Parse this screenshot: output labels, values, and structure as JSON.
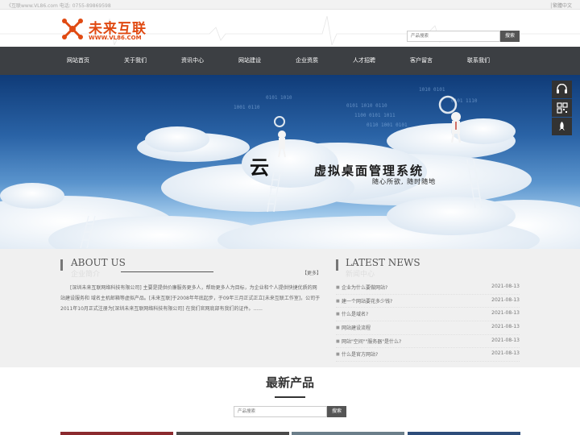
{
  "topbar": {
    "left_text": "《互联www.VL86.com 电话: 0755-89869598",
    "right_text": "│繁體中文"
  },
  "header": {
    "logo_name": "未来互联",
    "logo_url": "WWW.VL86.COM",
    "search": {
      "placeholder": "产品搜索",
      "button": "搜索"
    }
  },
  "nav": {
    "items": [
      "网站首页",
      "关于我们",
      "资讯中心",
      "网站建设",
      "企业资质",
      "人才招聘",
      "客户留言",
      "联系我们"
    ]
  },
  "banner": {
    "char": "云",
    "title": "虚拟桌面管理系统",
    "subtitle": "随心所欲, 随时随地"
  },
  "sidetools": [
    "headset-icon",
    "qrcode-icon",
    "rocket-icon"
  ],
  "about": {
    "title": "ABOUT US",
    "subtitle": "企业简介",
    "more": "【更多】",
    "text": "[深圳未来互联网络科技有限公司] 主要是提供价廉服务更多人，帮助更多人为目标，为企业和个人提供快捷优质的网站建设服务和 域名主机邮箱等虚拟产品。[未来互联]于2008年年底起步，于09年三月正式正立[未来互联工作室]，公司于2011年10月正式注册为[深圳未来互联网络科技有限公司] 在我们官网底部有我们的证件。......"
  },
  "news": {
    "title": "LATEST NEWS",
    "subtitle": "新闻中心",
    "items": [
      {
        "text": "企业为什么要做网站?",
        "date": "2021-08-13"
      },
      {
        "text": "建一个网站要花多少钱?",
        "date": "2021-08-13"
      },
      {
        "text": "什么是域名?",
        "date": "2021-08-13"
      },
      {
        "text": "网站建设流程",
        "date": "2021-08-13"
      },
      {
        "text": "网站\"空间\"\"服务器\"是什么?",
        "date": "2021-08-13"
      },
      {
        "text": "什么是官方网站?",
        "date": "2021-08-13"
      }
    ]
  },
  "products": {
    "title": "最新产品",
    "search": {
      "placeholder": "产品搜索",
      "button": "搜索"
    }
  },
  "colors": {
    "brand_orange": "#e04a12",
    "nav_bg": "#3c3f43",
    "banner_top": "#0f3b78",
    "card_colors": [
      "#8b2a2e",
      "#4a4a4a",
      "#6b7e8a",
      "#2d4d7a"
    ]
  }
}
